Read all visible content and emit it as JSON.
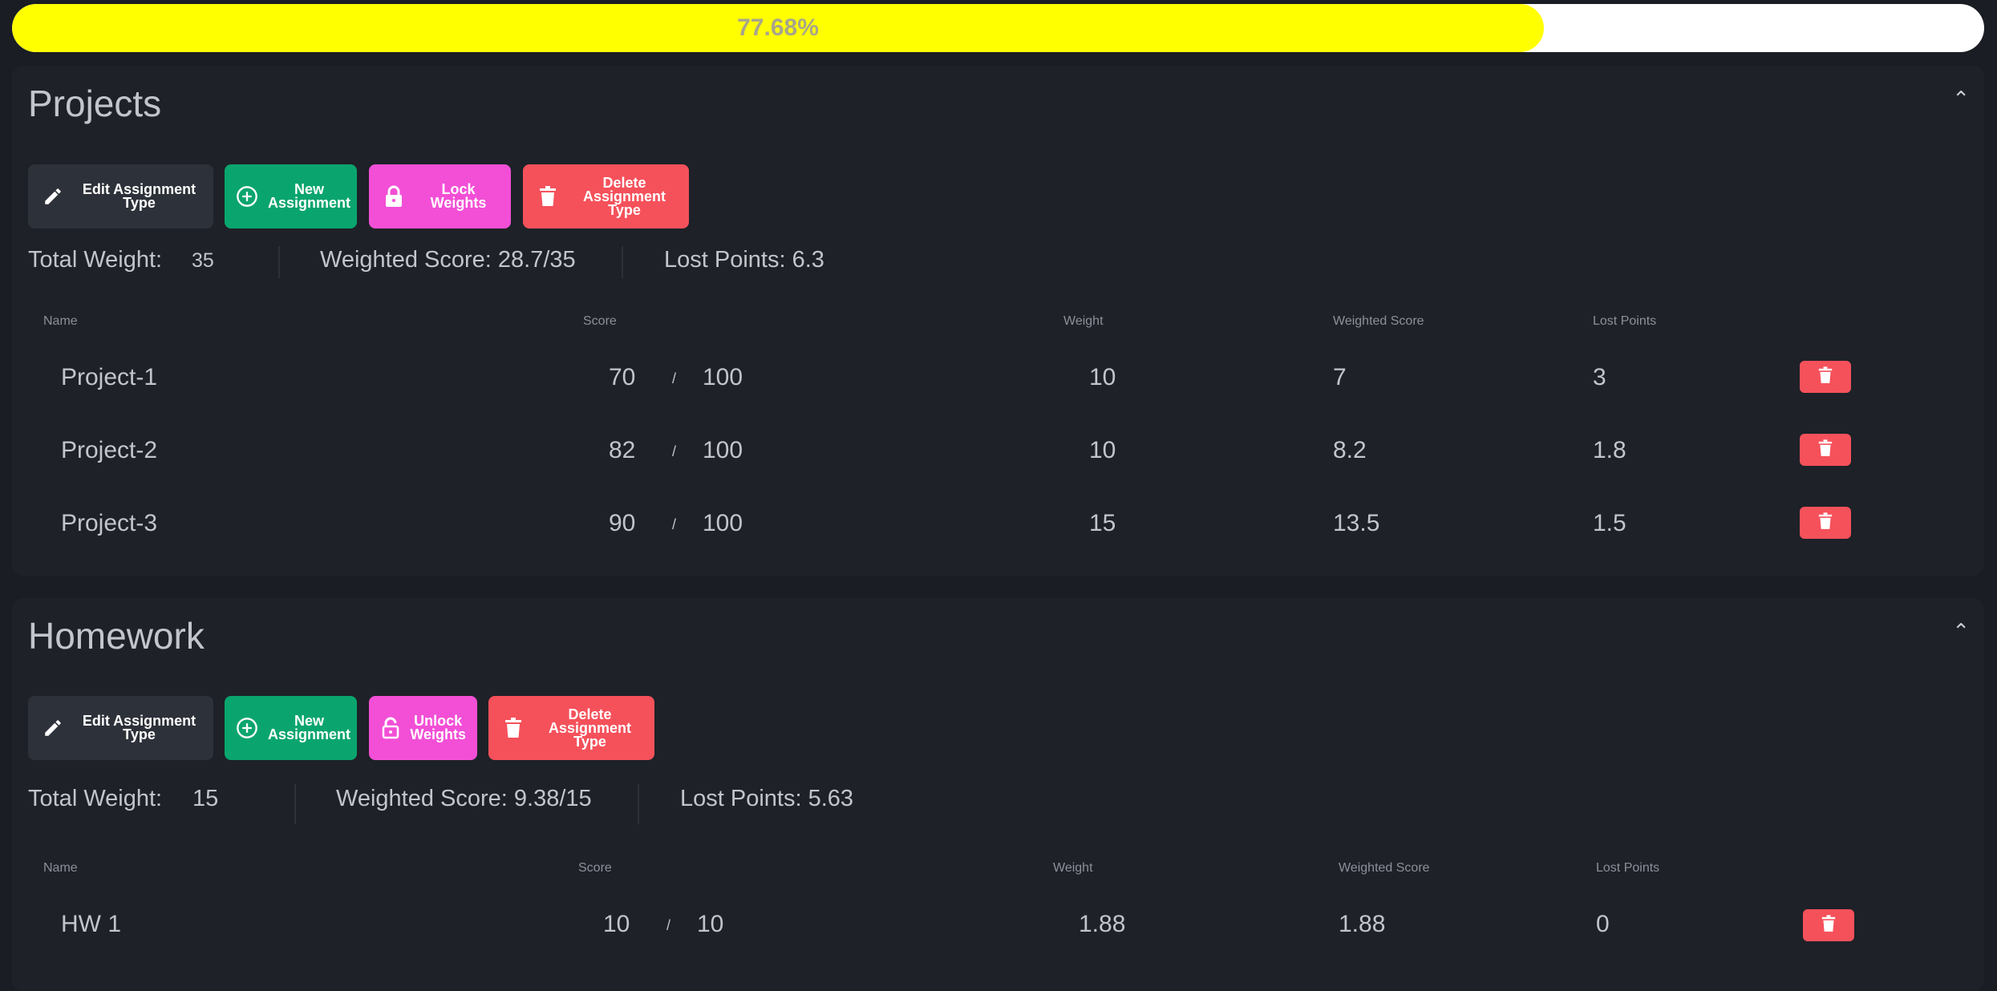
{
  "progress": {
    "label": "77.68%",
    "value_percent": 77.68,
    "fill_color": "#ffff00"
  },
  "sections": [
    {
      "title": "Projects",
      "buttons": {
        "edit": "Edit Assignment Type",
        "new_line1": "New",
        "new_line2": "Assignment",
        "lock": "Lock Weights",
        "delete_line1": "Delete",
        "delete_line2": "Assignment Type"
      },
      "stats": {
        "total_weight_label": "Total Weight:",
        "total_weight_value": "35",
        "weighted_score": "Weighted Score: 28.7/35",
        "lost_points": "Lost Points: 6.3"
      },
      "headers": [
        "Name",
        "Score",
        "Weight",
        "Weighted Score",
        "Lost Points"
      ],
      "rows": [
        {
          "name": "Project-1",
          "score": "70",
          "slash": "/",
          "max": "100",
          "weight": "10",
          "weighted": "7",
          "lost": "3"
        },
        {
          "name": "Project-2",
          "score": "82",
          "slash": "/",
          "max": "100",
          "weight": "10",
          "weighted": "8.2",
          "lost": "1.8"
        },
        {
          "name": "Project-3",
          "score": "90",
          "slash": "/",
          "max": "100",
          "weight": "15",
          "weighted": "13.5",
          "lost": "1.5"
        }
      ]
    },
    {
      "title": "Homework",
      "buttons": {
        "edit": "Edit Assignment Type",
        "new_line1": "New",
        "new_line2": "Assignment",
        "unlock_line1": "Unlock",
        "unlock_line2": "Weights",
        "delete_line1": "Delete",
        "delete_line2": "Assignment Type"
      },
      "stats": {
        "total_weight_label": "Total Weight:",
        "total_weight_value": "15",
        "weighted_score": "Weighted Score: 9.38/15",
        "lost_points": "Lost Points: 5.63"
      },
      "headers": [
        "Name",
        "Score",
        "Weight",
        "Weighted Score",
        "Lost Points"
      ],
      "rows": [
        {
          "name": "HW 1",
          "score": "10",
          "slash": "/",
          "max": "10",
          "weight": "1.88",
          "weighted": "1.88",
          "lost": "0"
        }
      ]
    }
  ],
  "icons": {
    "edit": "pencil-icon",
    "new": "plus-circle-icon",
    "lock": "lock-icon",
    "unlock": "unlock-icon",
    "delete": "trash-icon",
    "collapse": "chevron-up-icon"
  }
}
